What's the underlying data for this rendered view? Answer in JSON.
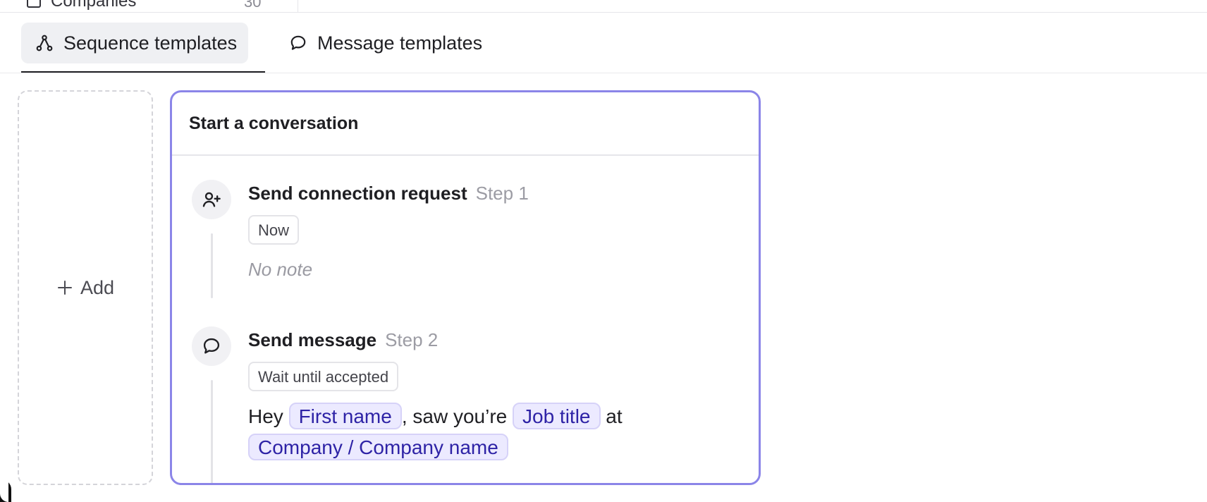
{
  "sidebar_remnant": {
    "label": "Companies",
    "count": "30"
  },
  "tabs": [
    {
      "label": "Sequence templates",
      "icon": "sequence-icon",
      "active": true
    },
    {
      "label": "Message templates",
      "icon": "chat-bubble-icon",
      "active": false
    }
  ],
  "add_card": {
    "label": "Add",
    "icon": "plus-icon"
  },
  "template": {
    "title": "Start a conversation",
    "steps": [
      {
        "title": "Send connection request",
        "step_label": "Step 1",
        "icon": "user-plus-icon",
        "timing": "Now",
        "note": "No note"
      },
      {
        "title": "Send message",
        "step_label": "Step 2",
        "icon": "chat-bubble-icon",
        "timing": "Wait until accepted",
        "message": {
          "text_1": "Hey ",
          "var_1": "First name",
          "text_2": ", saw you’re ",
          "var_2": "Job title",
          "text_3": " at",
          "var_3": "Company / Company name"
        }
      }
    ]
  },
  "colors": {
    "accent_border": "#8b85e8",
    "chip_bg": "#eceaff",
    "chip_text": "#2e23a6",
    "active_tab_bg": "#eff0f3"
  }
}
